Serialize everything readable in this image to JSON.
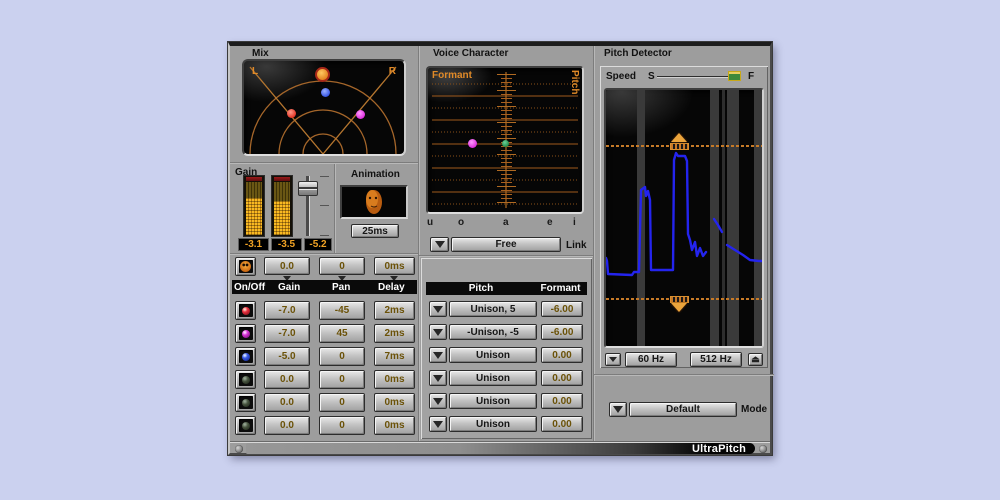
{
  "window": {
    "brand": "UltraPitch"
  },
  "mix": {
    "title": "Mix",
    "left_label": "L",
    "right_label": "R"
  },
  "gain": {
    "title": "Gain",
    "meter_values": [
      "-3.1",
      "-3.5",
      "-5.2"
    ]
  },
  "animation": {
    "title": "Animation",
    "latency_button": "25ms"
  },
  "master_row": {
    "gain": "0.0",
    "pan": "0",
    "delay": "0ms"
  },
  "voices_table": {
    "headers": [
      "On/Off",
      "Gain",
      "Pan",
      "Delay"
    ],
    "rows": [
      {
        "led": "red",
        "gain": "-7.0",
        "pan": "-45",
        "delay": "2ms"
      },
      {
        "led": "magenta",
        "gain": "-7.0",
        "pan": "45",
        "delay": "2ms"
      },
      {
        "led": "blue",
        "gain": "-5.0",
        "pan": "0",
        "delay": "7ms"
      },
      {
        "led": "off",
        "gain": "0.0",
        "pan": "0",
        "delay": "0ms"
      },
      {
        "led": "off",
        "gain": "0.0",
        "pan": "0",
        "delay": "0ms"
      },
      {
        "led": "off",
        "gain": "0.0",
        "pan": "0",
        "delay": "0ms"
      }
    ]
  },
  "voice_character": {
    "title": "Voice Character",
    "formant_label": "Formant",
    "pitch_label": "Pitch",
    "vowels": [
      "u",
      "o",
      "a",
      "e",
      "i"
    ],
    "mode_button": "Free",
    "link_label": "Link"
  },
  "pitch_table": {
    "header_pitch": "Pitch",
    "header_formant": "Formant",
    "rows": [
      {
        "pitch": "Unison, 5",
        "formant": "-6.00"
      },
      {
        "pitch": "-Unison, -5",
        "formant": "-6.00"
      },
      {
        "pitch": "Unison",
        "formant": "0.00"
      },
      {
        "pitch": "Unison",
        "formant": "0.00"
      },
      {
        "pitch": "Unison",
        "formant": "0.00"
      },
      {
        "pitch": "Unison",
        "formant": "0.00"
      }
    ]
  },
  "pitch_detector": {
    "title": "Pitch Detector",
    "speed_label": "Speed",
    "slow_label": "S",
    "fast_label": "F",
    "low_freq_button": "60 Hz",
    "high_freq_button": "512 Hz"
  },
  "mode": {
    "label": "Mode",
    "value": "Default"
  },
  "colors": {
    "accent_orange": "#e08a28",
    "lcd_orange": "#f0a224",
    "curve_blue": "#2424ee",
    "led_red": "#e83040",
    "led_magenta": "#d835d8",
    "led_blue": "#3a5ae8",
    "background": "#cbd1ef"
  }
}
